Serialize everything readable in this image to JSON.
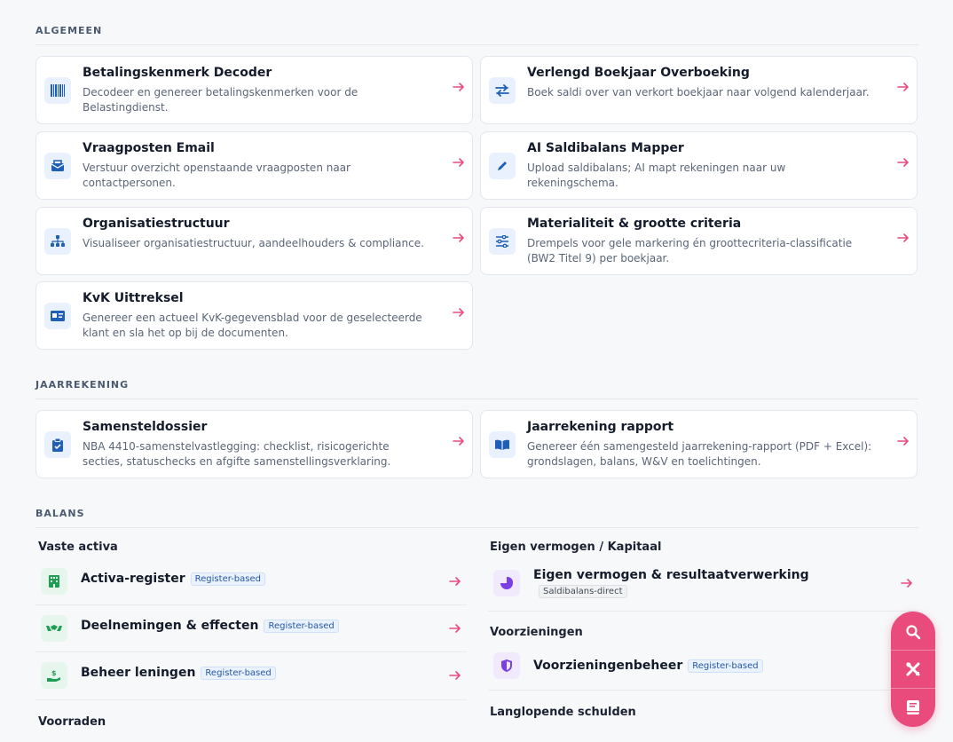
{
  "sections": {
    "algemeen": "ALGEMEEN",
    "jaarrekening": "JAARREKENING",
    "balans": "BALANS"
  },
  "algemeen_cards": [
    {
      "title": "Betalingskenmerk Decoder",
      "desc": "Decodeer en genereer betalingskenmerken voor de Belastingdienst.",
      "icon": "barcode-icon"
    },
    {
      "title": "Verlengd Boekjaar Overboeking",
      "desc": "Boek saldi over van verkort boekjaar naar volgend kalenderjaar.",
      "icon": "swap-arrows-icon"
    },
    {
      "title": "Vraagposten Email",
      "desc": "Verstuur overzicht openstaande vraagposten naar contactpersonen.",
      "icon": "mail-icon"
    },
    {
      "title": "AI Saldibalans Mapper",
      "desc": "Upload saldibalans; AI mapt rekeningen naar uw rekeningschema.",
      "icon": "pencil-icon"
    },
    {
      "title": "Organisatiestructuur",
      "desc": "Visualiseer organisatiestructuur, aandeelhouders & compliance.",
      "icon": "org-chart-icon"
    },
    {
      "title": "Materialiteit & grootte criteria",
      "desc": "Drempels voor gele markering én groottecriteria-classificatie (BW2 Titel 9) per boekjaar.",
      "icon": "sliders-icon"
    },
    {
      "title": "KvK Uittreksel",
      "desc": "Genereer een actueel KvK-gegevensblad voor de geselecteerde klant en sla het op bij de documenten.",
      "icon": "id-card-icon"
    }
  ],
  "jaarrekening_cards": [
    {
      "title": "Samensteldossier",
      "desc": "NBA 4410-samenstelvastlegging: checklist, risicogerichte secties, statuschecks en afgifte samenstellingsverklaring.",
      "icon": "clipboard-check-icon"
    },
    {
      "title": "Jaarrekening rapport",
      "desc": "Genereer één samengesteld jaarrekening-rapport (PDF + Excel): grondslagen, balans, W&V en toelichtingen.",
      "icon": "book-open-icon"
    }
  ],
  "balans": {
    "left": {
      "vaste_activa": "Vaste activa",
      "items": [
        {
          "title": "Activa-register",
          "badge": "Register-based",
          "icon": "building-icon"
        },
        {
          "title": "Deelnemingen & effecten",
          "badge": "Register-based",
          "icon": "handshake-icon"
        },
        {
          "title": "Beheer leningen",
          "badge": "Register-based",
          "icon": "hand-coin-icon"
        }
      ],
      "voorraden": "Voorraden"
    },
    "right": {
      "eigen_vermogen": "Eigen vermogen / Kapitaal",
      "ev_item": {
        "title": "Eigen vermogen & resultaatverwerking",
        "badge": "Saldibalans-direct",
        "icon": "pie-chart-icon"
      },
      "voorzieningen": "Voorzieningen",
      "vz_item": {
        "title": "Voorzieningenbeheer",
        "badge": "Register-based",
        "icon": "shield-icon"
      },
      "langlopende": "Langlopende schulden"
    }
  },
  "colors": {
    "accent": "#e84b7c",
    "icon_blue": "#1f5fb8",
    "icon_bg": "#e8f1fd"
  },
  "fab": [
    "search-icon",
    "tools-icon",
    "book-icon"
  ]
}
